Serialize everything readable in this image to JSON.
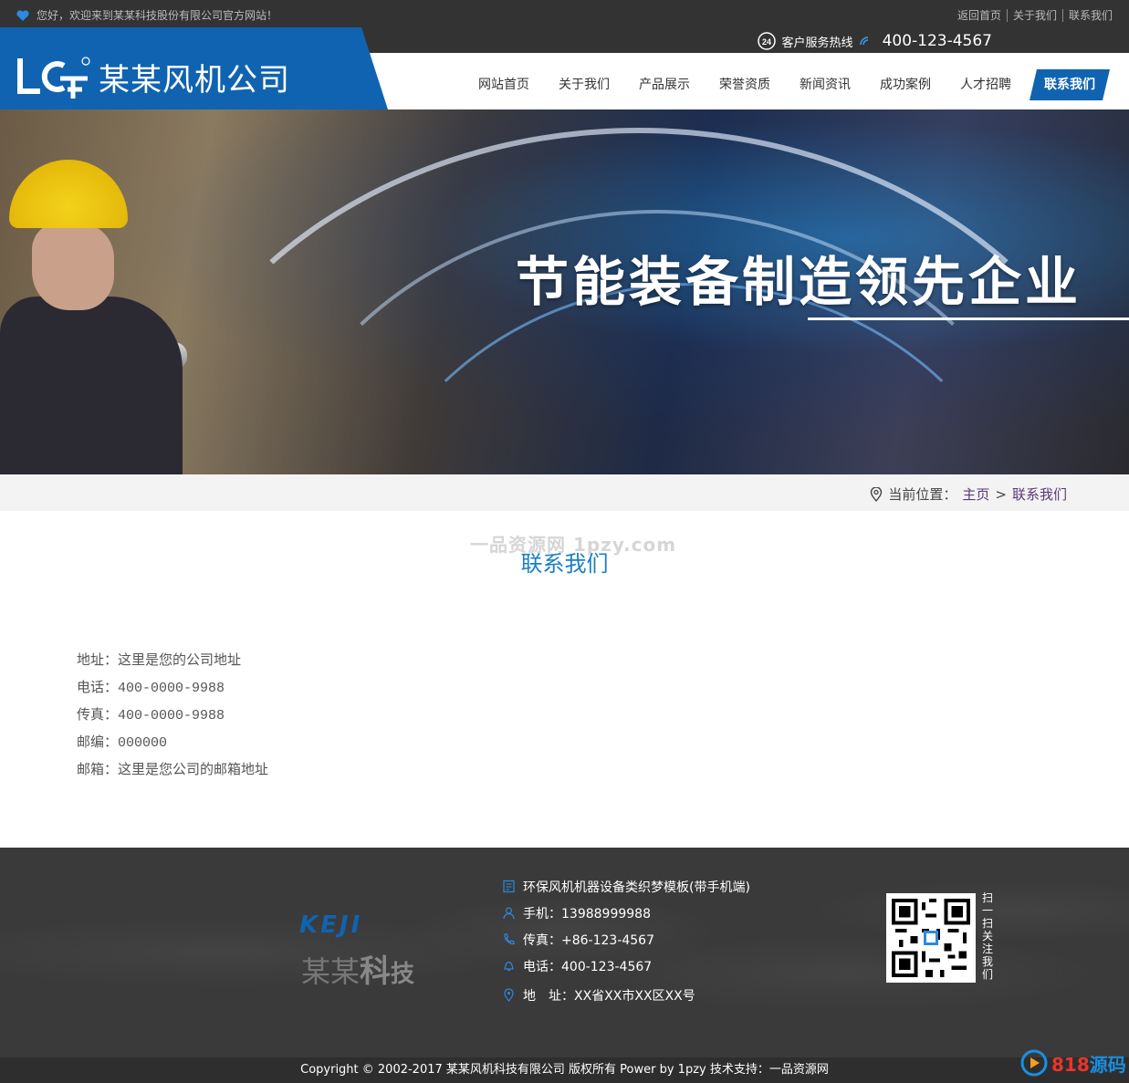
{
  "topbar": {
    "welcome": "您好，欢迎来到某某科技股份有限公司官方网站！",
    "links": [
      "返回首页",
      "关于我们",
      "联系我们"
    ]
  },
  "hotline": {
    "label": "客户服务热线",
    "number": "400-123-4567"
  },
  "logo": {
    "text": "某某风机公司"
  },
  "nav": {
    "items": [
      "网站首页",
      "关于我们",
      "产品展示",
      "荣誉资质",
      "新闻资讯",
      "成功案例",
      "人才招聘"
    ],
    "active": "联系我们"
  },
  "banner": {
    "slogan": "节能装备制造领先企业"
  },
  "breadcrumb": {
    "prefix": "当前位置：",
    "home": "主页",
    "sep": ">",
    "current": "联系我们"
  },
  "section_title": "联系我们",
  "watermark_1pzy": "一品资源网 1pzy.com",
  "info": [
    {
      "label": "地址：",
      "value": "这里是您的公司地址"
    },
    {
      "label": "电话：",
      "value": "400-0000-9988"
    },
    {
      "label": "传真：",
      "value": "400-0000-9988"
    },
    {
      "label": "邮编：",
      "value": "000000"
    },
    {
      "label": "邮箱：",
      "value": "这里是您公司的邮箱地址"
    }
  ],
  "footer": {
    "keji": "KEJI",
    "brand_a": "某某",
    "brand_b": "科",
    "brand_c": "技",
    "contacts": [
      {
        "icon": "document-icon",
        "text": "环保风机机器设备类织梦模板(带手机端)"
      },
      {
        "icon": "user-icon",
        "text": "手机：13988999988"
      },
      {
        "icon": "phone-icon",
        "text": "传真：+86-123-4567"
      },
      {
        "icon": "bell-icon",
        "text": "电话：400-123-4567"
      },
      {
        "icon": "location-icon",
        "text": "地　址：XX省XX市XX区XX号"
      }
    ],
    "qr_label": "扫一扫关注我们"
  },
  "copyright": "Copyright © 2002-2017 某某风机科技有限公司 版权所有 Power by 1pzy 技术支持：一品资源网",
  "watermark_818": {
    "a": "818",
    "b": "源码"
  },
  "colors": {
    "brand": "#1063b0",
    "title": "#1a7fc4",
    "dark": "#333333"
  }
}
